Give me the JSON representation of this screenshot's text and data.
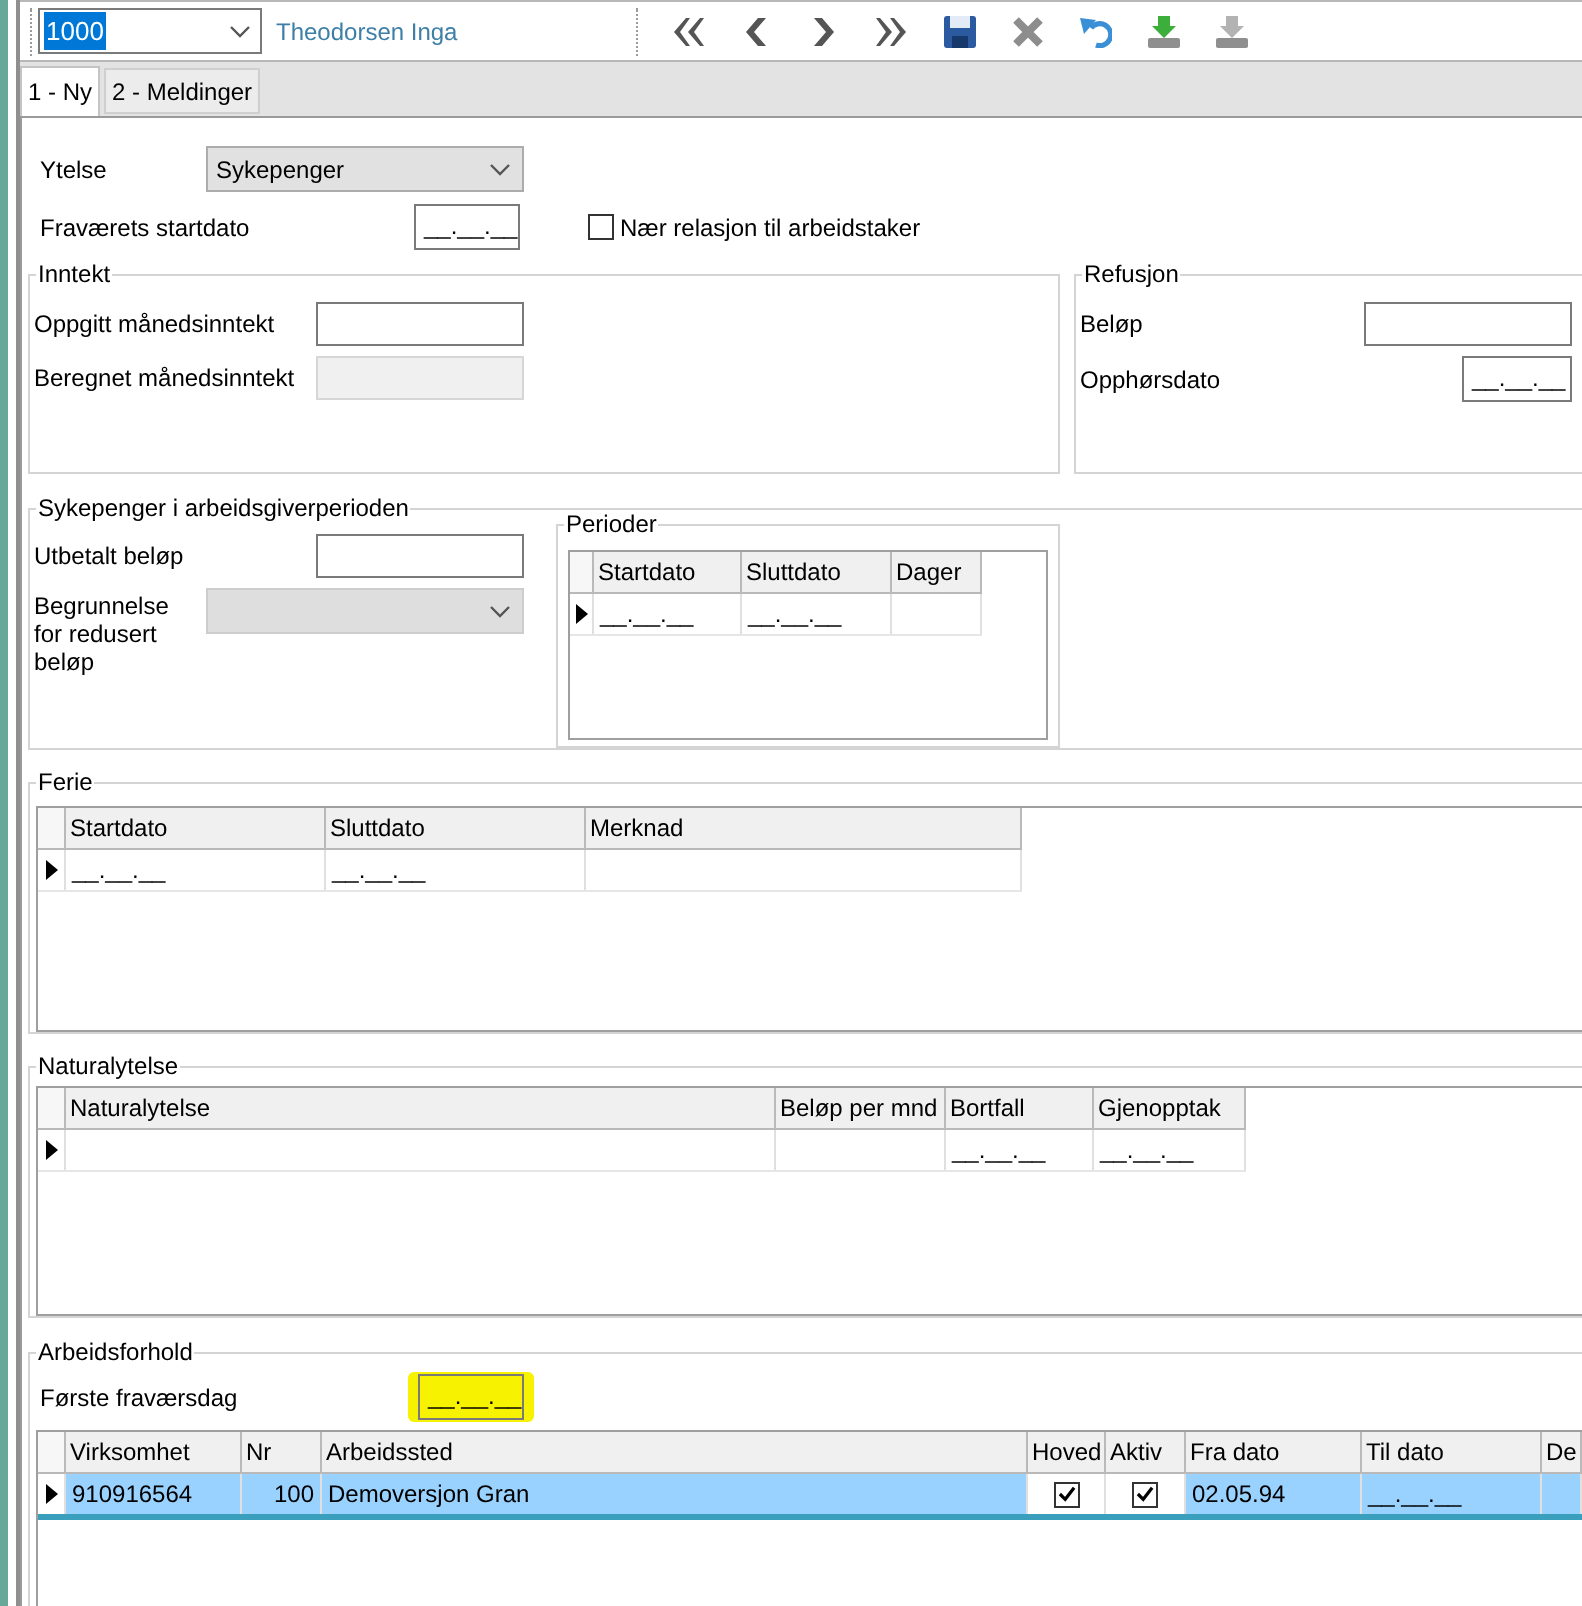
{
  "toolbar": {
    "record": {
      "value": "1000",
      "text_selected": true
    },
    "name": "Theodorsen Inga",
    "buttons": [
      {
        "kind": "first",
        "disabled": false
      },
      {
        "kind": "previous",
        "disabled": false
      },
      {
        "kind": "next",
        "disabled": false
      },
      {
        "kind": "last",
        "disabled": false
      },
      {
        "kind": "save",
        "disabled": false
      },
      {
        "kind": "delete",
        "disabled": true
      },
      {
        "kind": "undo",
        "disabled": false
      },
      {
        "kind": "import",
        "disabled": false
      },
      {
        "kind": "export",
        "disabled": true
      }
    ]
  },
  "tabs": [
    {
      "label": "1 - Ny",
      "selected": true
    },
    {
      "label": "2 - Meldinger",
      "selected": false
    }
  ],
  "ytelse": {
    "label": "Ytelse",
    "value": "Sykepenger"
  },
  "startdato": {
    "label": "Fraværets startdato",
    "value": "__.__.__"
  },
  "relation": {
    "label": "Nær relasjon til arbeidstaker",
    "checked": false
  },
  "inntekt": {
    "title": "Inntekt",
    "fields": [
      {
        "label": "Oppgitt månedsinntekt",
        "kind": "text",
        "disabled": false
      },
      {
        "label": "Beregnet månedsinntekt",
        "kind": "text",
        "disabled": true
      }
    ]
  },
  "refusjon": {
    "title": "Refusjon",
    "fields": [
      {
        "label": "Beløp",
        "kind": "text"
      },
      {
        "label": "Opphørsdato",
        "kind": "date",
        "value": "__.__.__"
      }
    ]
  },
  "arbeidsgiverperioden": {
    "title": "Sykepenger i arbeidsgiverperioden",
    "utbetalt": {
      "label": "Utbetalt beløp"
    },
    "begrunnelse": {
      "label": "Begrunnelse for redusert beløp",
      "disabled": true
    },
    "perioder": {
      "title": "Perioder",
      "columns": [
        {
          "label": "Startdato"
        },
        {
          "label": "Sluttdato"
        },
        {
          "label": "Dager"
        }
      ],
      "rows": [
        {
          "current": true,
          "selected": false,
          "cells": [
            "__.__.__",
            "__.__.__",
            null
          ]
        }
      ]
    }
  },
  "ferie": {
    "title": "Ferie",
    "columns": [
      {
        "label": "Startdato"
      },
      {
        "label": "Sluttdato"
      },
      {
        "label": "Merknad"
      }
    ],
    "rows": [
      {
        "current": true,
        "selected": false,
        "cells": [
          "__.__.__",
          "__.__.__",
          null
        ]
      }
    ]
  },
  "naturalytelse": {
    "title": "Naturalytelse",
    "columns": [
      {
        "label": "Naturalytelse"
      },
      {
        "label": "Beløp per mnd"
      },
      {
        "label": "Bortfall"
      },
      {
        "label": "Gjenopptak"
      }
    ],
    "rows": [
      {
        "current": true,
        "selected": false,
        "cells": [
          null,
          null,
          "__.__.__",
          "__.__.__"
        ]
      }
    ]
  },
  "arbeidsforhold": {
    "title": "Arbeidsforhold",
    "forste": {
      "label": "Første fraværsdag",
      "value": "__.__.__",
      "highlighted": true
    },
    "columns": [
      {
        "label": "Virksomhet",
        "kind": "text"
      },
      {
        "label": "Nr",
        "kind": "number"
      },
      {
        "label": "Arbeidssted",
        "kind": "text"
      },
      {
        "label": "Hoved",
        "kind": "check"
      },
      {
        "label": "Aktiv",
        "kind": "check"
      },
      {
        "label": "Fra dato",
        "kind": "text"
      },
      {
        "label": "Til dato",
        "kind": "text"
      },
      {
        "label": "De",
        "kind": "text"
      }
    ],
    "rows": [
      {
        "current": true,
        "selected": true,
        "cells": [
          "910916564",
          "100",
          "Demoversjon Gran",
          {
            "checked": true
          },
          {
            "checked": true
          },
          "02.05.94",
          "__.__.__",
          null
        ]
      }
    ]
  }
}
